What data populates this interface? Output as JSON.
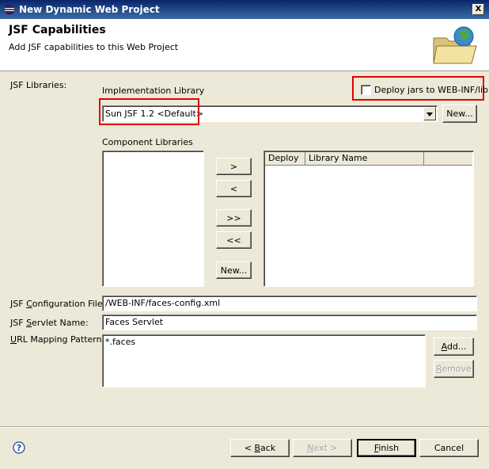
{
  "window": {
    "title": "New Dynamic Web Project",
    "close": "X"
  },
  "header": {
    "title": "JSF Capabilities",
    "subtitle": "Add JSF capabilities to this Web Project"
  },
  "libraries": {
    "section_label": "JSF Libraries:",
    "impl_label": "Implementation Library",
    "impl_selected": "Sun JSF 1.2 <Default>",
    "new_button": "New...",
    "deploy_checkbox": {
      "label": "Deploy jars to WEB-INF/lib",
      "checked": false
    },
    "component_label": "Component Libraries",
    "move_buttons": [
      ">",
      "<",
      ">>",
      "<<"
    ],
    "component_new_button": "New...",
    "table_columns": [
      "Deploy",
      "Library Name"
    ]
  },
  "config": {
    "config_file_label": "JSF Configuration File:",
    "config_file_value": "/WEB-INF/faces-config.xml",
    "servlet_label": "JSF Servlet Name:",
    "servlet_value": "Faces Servlet",
    "url_label": "URL Mapping Patterns:",
    "url_patterns": [
      "*.faces"
    ],
    "add_button": "Add...",
    "remove_button": "Remove"
  },
  "footer": {
    "help": "?",
    "back": "< Back",
    "next": "Next >",
    "finish": "Finish",
    "cancel": "Cancel"
  }
}
